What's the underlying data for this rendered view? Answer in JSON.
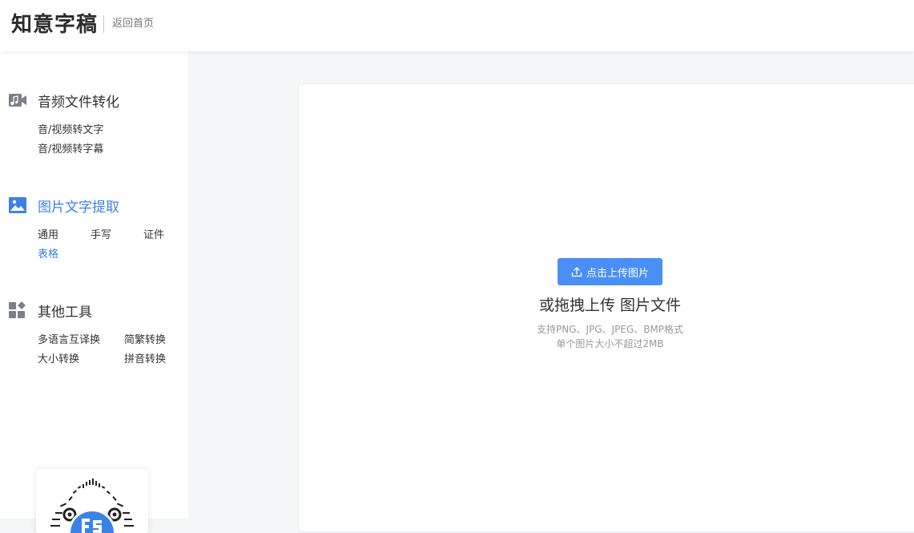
{
  "header": {
    "logo": "知意字稿",
    "back_link": "返回首页"
  },
  "sidebar": {
    "sections": [
      {
        "title": "音频文件转化",
        "icon": "video-music-icon",
        "items": [
          "音/视频转文字",
          "音/视频转字幕"
        ]
      },
      {
        "title": "图片文字提取",
        "icon": "image-icon",
        "items": [
          "通用",
          "手写",
          "证件",
          "表格"
        ]
      },
      {
        "title": "其他工具",
        "icon": "apps-grid-icon",
        "items": [
          "多语言互译换",
          "简繁转换",
          "大小转换",
          "拼音转换"
        ]
      }
    ]
  },
  "upload": {
    "button_label": "点击上传图片",
    "drag_text": "或拖拽上传 图片文件",
    "hint_formats": "支持PNG、JPG、JPEG、BMP格式",
    "hint_size": "单个图片大小不超过2MB"
  },
  "colors": {
    "accent": "#3b82e6",
    "button": "#4a8ff5"
  }
}
